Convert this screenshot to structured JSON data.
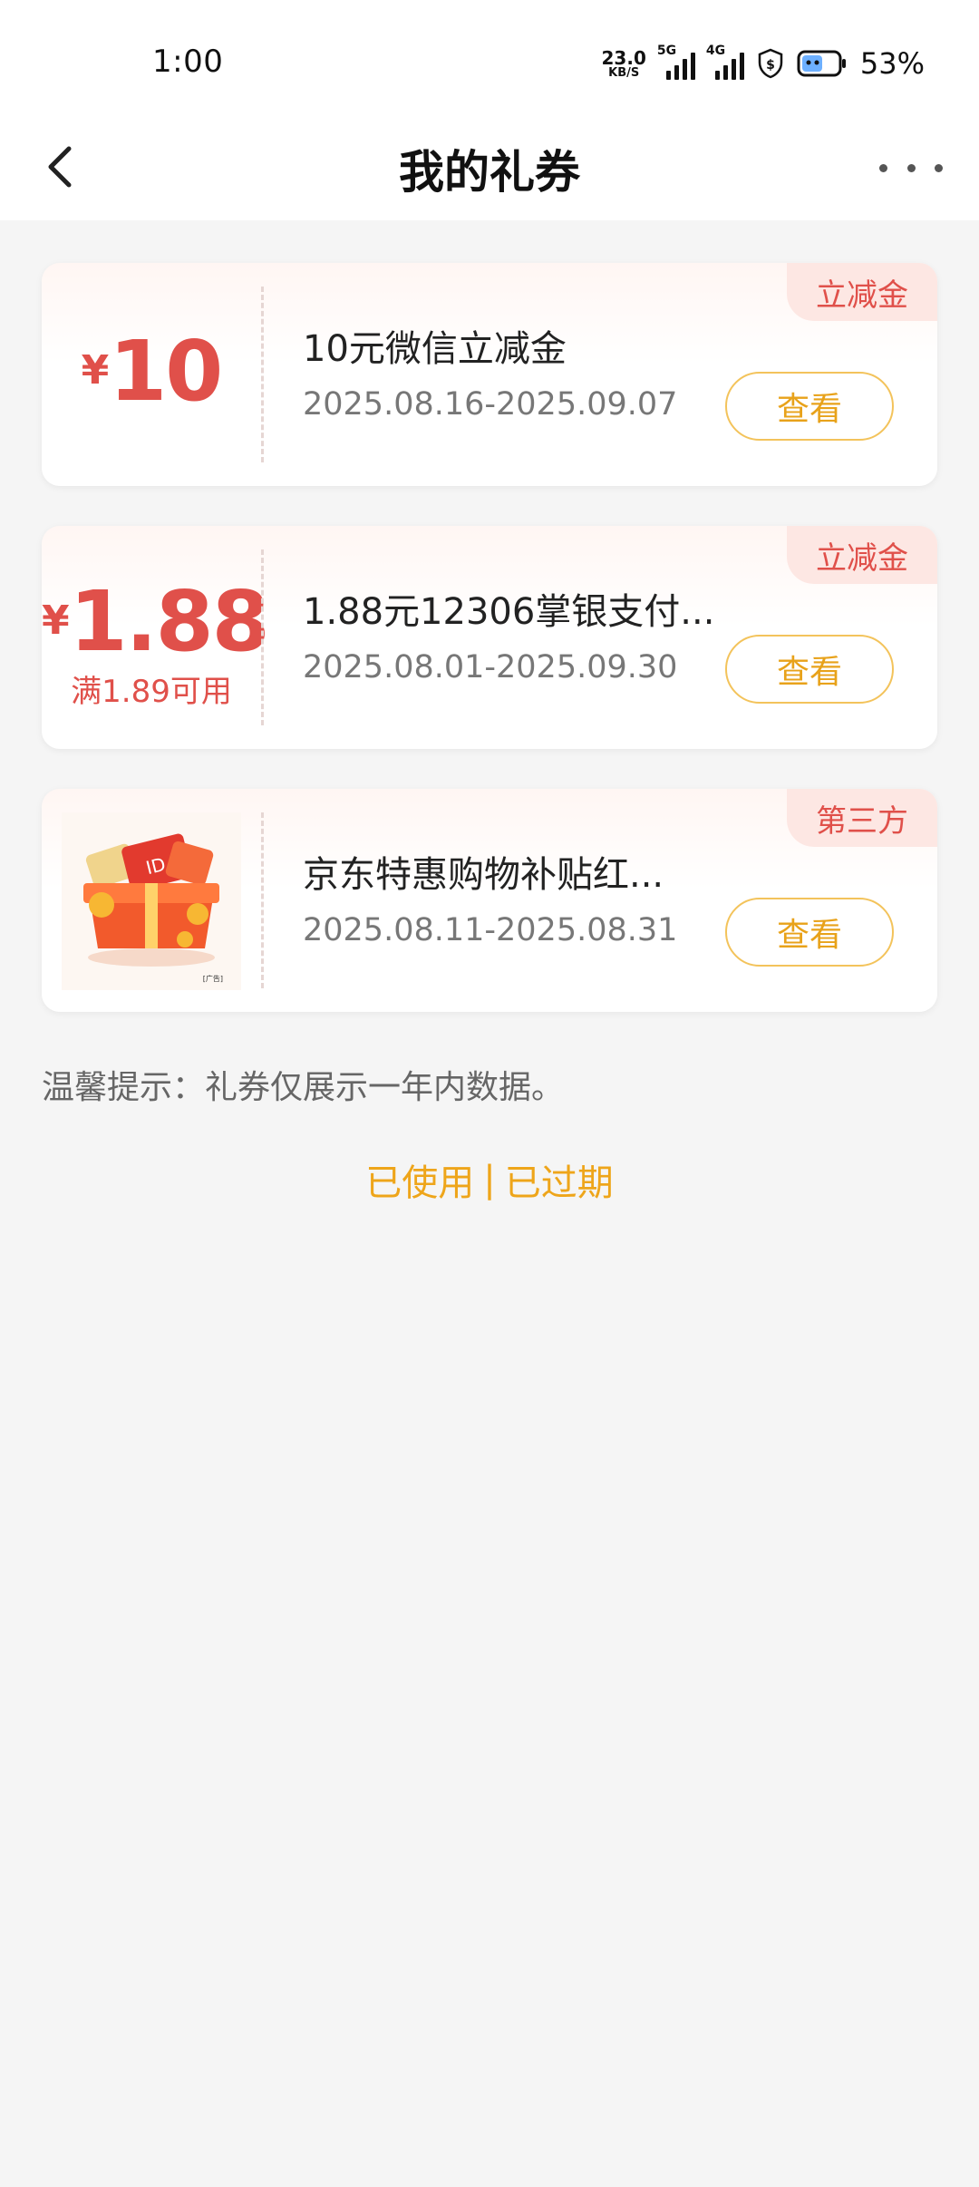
{
  "status_bar": {
    "time": "1:00",
    "net_speed_value": "23.0",
    "net_speed_unit": "KB/S",
    "signal1_label": "5G",
    "signal2_label": "4G",
    "battery_percent": "53%"
  },
  "header": {
    "title": "我的礼券"
  },
  "coupons": [
    {
      "currency": "¥",
      "amount": "10",
      "condition": "",
      "title": "10元微信立减金",
      "date_range": "2025.08.16-2025.09.07",
      "badge": "立减金",
      "button_label": "查看"
    },
    {
      "currency": "¥",
      "amount": "1.88",
      "condition": "满1.89可用",
      "title": "1.88元12306掌银支付...",
      "date_range": "2025.08.01-2025.09.30",
      "badge": "立减金",
      "button_label": "查看"
    },
    {
      "image": "gift-box-icon",
      "image_caption": "[广告]",
      "title": "京东特惠购物补贴红...",
      "date_range": "2025.08.11-2025.08.31",
      "badge": "第三方",
      "button_label": "查看"
    }
  ],
  "tip": "温馨提示：礼券仅展示一年内数据。",
  "links": {
    "used": "已使用",
    "separator": "|",
    "expired": "已过期"
  },
  "colors": {
    "accent_red": "#e0504a",
    "accent_orange": "#eea51a",
    "background": "#f5f5f5"
  }
}
